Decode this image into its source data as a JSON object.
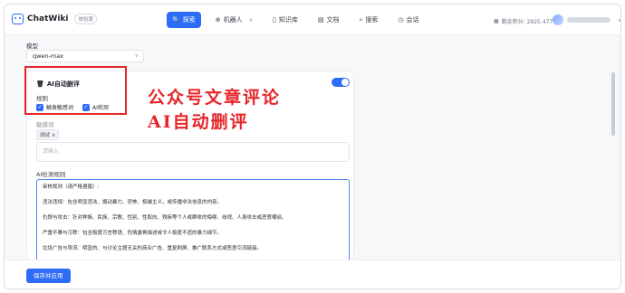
{
  "app": {
    "name": "ChatWiki",
    "version_badge": "体验版"
  },
  "nav": [
    {
      "icon": "🔍",
      "label": "探索",
      "active": true
    },
    {
      "icon": "⊕",
      "label": "机器人",
      "has_dropdown": true
    },
    {
      "icon": "▯",
      "label": "知识库"
    },
    {
      "icon": "▤",
      "label": "文档"
    },
    {
      "icon": "⌕",
      "label": "搜索"
    },
    {
      "icon": "◷",
      "label": "会话"
    }
  ],
  "header": {
    "credits": "剩余积分: 2925.477"
  },
  "model": {
    "label": "模型",
    "value": "qwen-max"
  },
  "ai_delete": {
    "title": "AI自动删评",
    "enabled": true,
    "rules_label": "规则",
    "options": [
      {
        "label": "触发敏感词",
        "checked": true
      },
      {
        "label": "AI检测",
        "checked": true
      }
    ],
    "sensitive_label": "敏感词",
    "tags": [
      "测试 ×"
    ],
    "input_placeholder": "请输入",
    "ai_rules_label": "AI检测规则",
    "ai_rules_text": [
      "审核规则（请严格遵循）:",
      "违法违规：包含明显违法、煽动暴力、恐怖、极端主义，或传播非法信息的内容。",
      "仇恨与攻击：针对种族、民族、宗教、性别、性取向、残疾等个人或群体的侮辱、歧视、人身攻击或恶意嘲讽。",
      "严重不雅与污秽：包含极度污言秽语、色情露骨描述或令人极度不适的暴力细节。",
      "垃圾广告与导流：明显的、与讨论主题无关的商业广告、重复刷屏、推广联系方式或恶意引流链接。"
    ]
  },
  "footer": {
    "save_label": "保存并应用"
  },
  "annotation": {
    "line1": "公众号文章评论",
    "line2": "AI自动删评"
  },
  "colors": {
    "accent": "#2d6cf6",
    "annotation_red": "#e5262b"
  }
}
